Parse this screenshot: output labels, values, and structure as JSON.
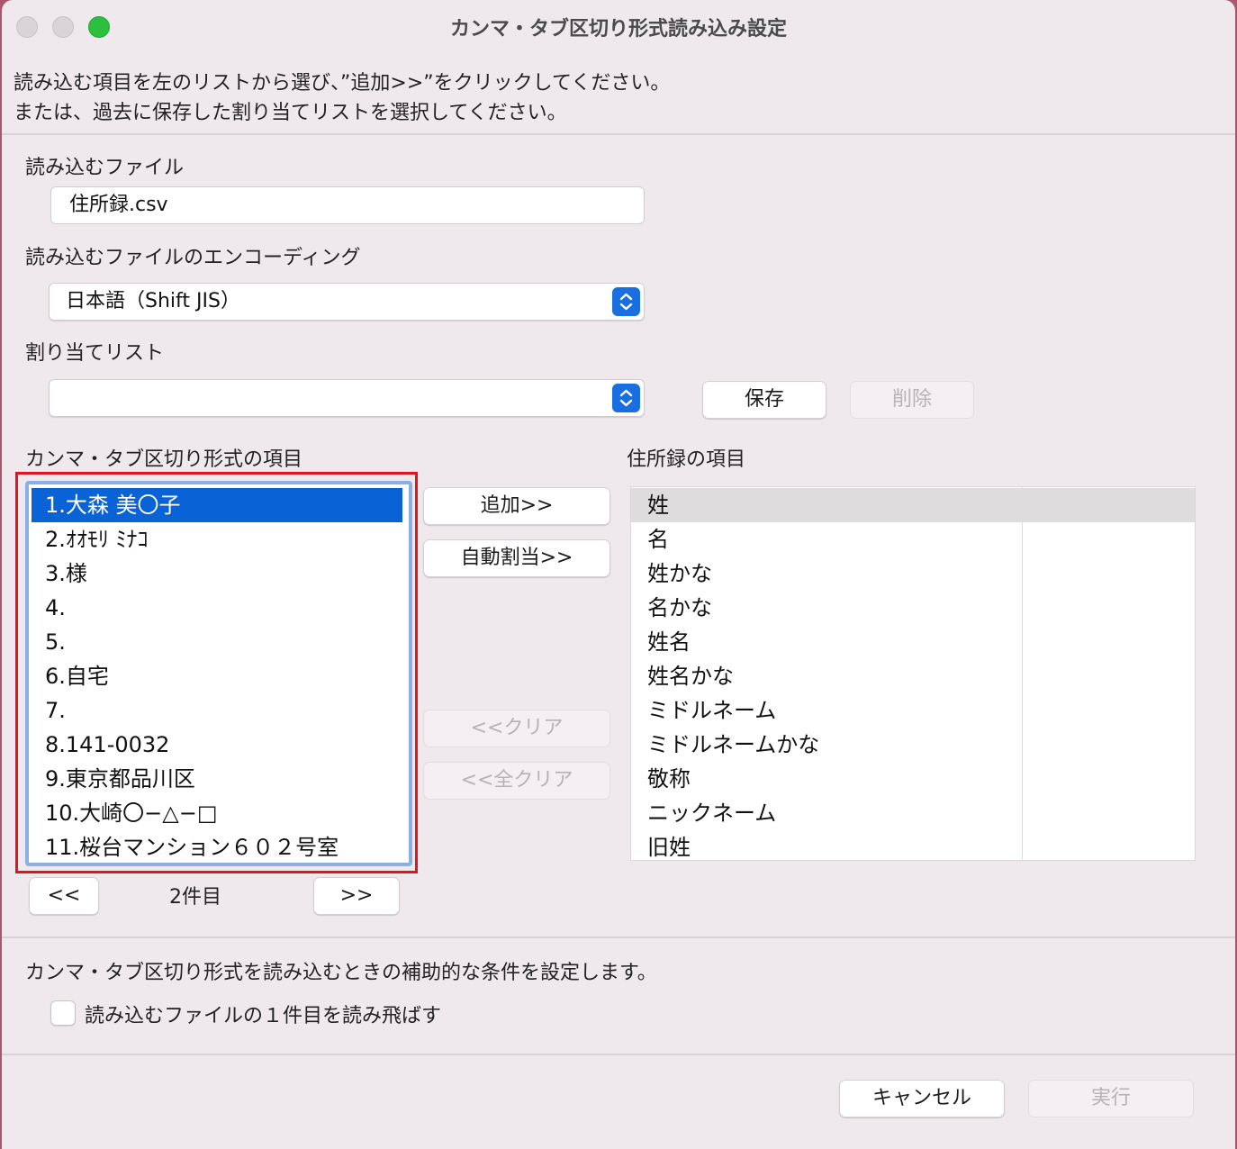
{
  "window": {
    "title": "カンマ・タブ区切り形式読み込み設定",
    "accent_color": "#0a63d6",
    "highlight_color": "#e0151d"
  },
  "instructions": {
    "line1": "読み込む項目を左のリストから選び、”追加>>”をクリックしてください。",
    "line2": "または、過去に保存した割り当てリストを選択してください。"
  },
  "file": {
    "label": "読み込むファイル",
    "value": "住所録.csv"
  },
  "encoding": {
    "label": "読み込むファイルのエンコーディング",
    "selected": "日本語（Shift JIS）"
  },
  "assignment": {
    "label": "割り当てリスト",
    "selected": "",
    "save_label": "保存",
    "delete_label": "削除"
  },
  "source_list": {
    "label": "カンマ・タブ区切り形式の項目",
    "items": [
      "1.大森 美〇子",
      "2.ｵｵﾓﾘ ﾐﾅｺ",
      "3.様",
      "4.",
      "5.",
      "6.自宅",
      "7.",
      "8.141-0032",
      "9.東京都品川区",
      "10.大崎〇−△−□",
      "11.桜台マンション６０２号室"
    ],
    "selected_index": 0,
    "prev_label": "<<",
    "next_label": ">>",
    "record_label": "2件目"
  },
  "middle_buttons": {
    "add": "追加>>",
    "auto_assign": "自動割当>>",
    "clear": "<<クリア",
    "clear_all": "<<全クリア"
  },
  "target_list": {
    "label": "住所録の項目",
    "items": [
      "姓",
      "名",
      "姓かな",
      "名かな",
      "姓名",
      "姓名かな",
      "ミドルネーム",
      "ミドルネームかな",
      "敬称",
      "ニックネーム",
      "旧姓"
    ],
    "selected_index": 0
  },
  "options": {
    "description": "カンマ・タブ区切り形式を読み込むときの補助的な条件を設定します。",
    "skip_first_label": "読み込むファイルの１件目を読み飛ばす",
    "skip_first_checked": false
  },
  "footer": {
    "cancel": "キャンセル",
    "run": "実行"
  }
}
